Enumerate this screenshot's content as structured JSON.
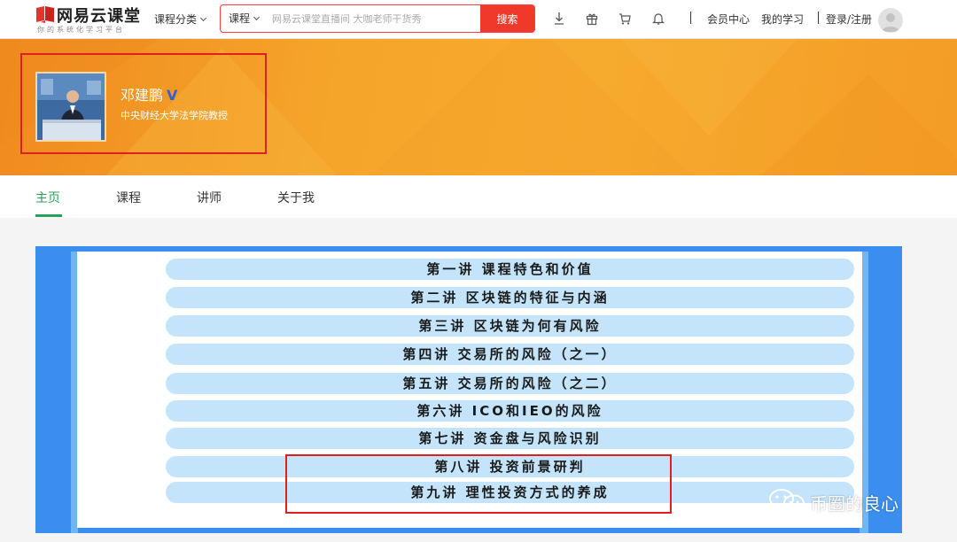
{
  "header": {
    "logo_name": "网易云课堂",
    "logo_slogan": "你的系统化学习平台",
    "category_menu": "课程分类",
    "search_type": "课程",
    "search_placeholder": "网易云课堂直播间 大咖老师干货秀",
    "search_button": "搜索",
    "member_center": "会员中心",
    "my_learning": "我的学习",
    "login_register": "登录/注册"
  },
  "profile": {
    "name": "邓建鹏",
    "verified_mark": "V",
    "title": "中央财经大学法学院教授"
  },
  "tabs": [
    {
      "label": "主页",
      "active": true
    },
    {
      "label": "课程",
      "active": false
    },
    {
      "label": "讲师",
      "active": false
    },
    {
      "label": "关于我",
      "active": false
    }
  ],
  "lectures": [
    "第一讲 课程特色和价值",
    "第二讲 区块链的特征与内涵",
    "第三讲 区块链为何有风险",
    "第四讲 交易所的风险（之一）",
    "第五讲 交易所的风险（之二）",
    "第六讲 ICO和IEO的风险",
    "第七讲 资金盘与风险识别",
    "第八讲 投资前景研判",
    "第九讲 理性投资方式的养成"
  ],
  "watermark": "币圈的良心",
  "colors": {
    "brand_red": "#f0392b",
    "active_tab_green": "#2aa15a",
    "banner_orange": "#f5a52a",
    "board_blue": "#3a8ef0",
    "pill_blue": "#c3e4fa",
    "highlight_red": "#e02020"
  }
}
